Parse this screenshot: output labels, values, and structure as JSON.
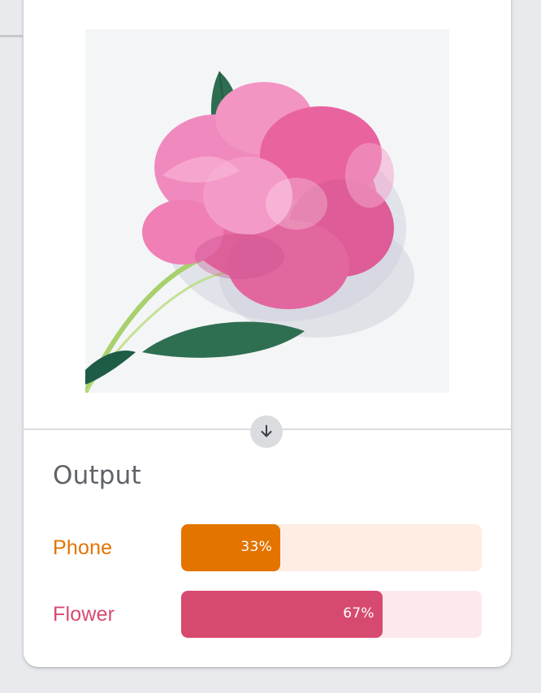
{
  "image": {
    "icon": "flower-photo",
    "alt": ""
  },
  "divider": {
    "icon": "arrow-down-icon"
  },
  "output": {
    "title": "Output",
    "results": [
      {
        "label": "Phone",
        "percent_text": "33%",
        "value": 0.33,
        "label_color": "#e37400",
        "bar_color": "#e37400",
        "track_color": "#feede3"
      },
      {
        "label": "Flower",
        "percent_text": "67%",
        "value": 0.67,
        "label_color": "#d74a6f",
        "bar_color": "#d74a6f",
        "track_color": "#fde8ed"
      }
    ]
  }
}
